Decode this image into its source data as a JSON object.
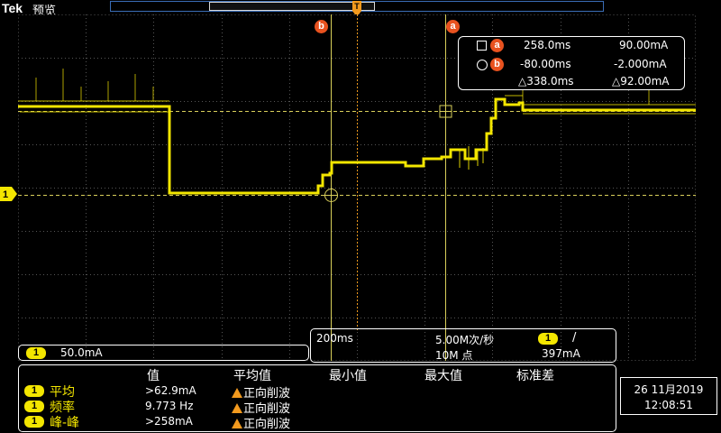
{
  "header": {
    "brand": "Tek",
    "mode": "预览",
    "trigger_position_marker": "T"
  },
  "cursors": {
    "cursor_b_label": "b",
    "cursor_a_label": "a"
  },
  "cursor_readout": {
    "row_a": {
      "label": "a",
      "time": "258.0ms",
      "value": "90.00mA"
    },
    "row_b": {
      "label": "b",
      "time": "-80.00ms",
      "value": "-2.000mA"
    },
    "delta": {
      "time": "△338.0ms",
      "value": "△92.00mA"
    }
  },
  "channel": {
    "label": "1",
    "scale": "50.0mA",
    "color": "#f3e600"
  },
  "timebase": {
    "horizontal_scale": "200ms",
    "sample_rate": "5.00M次/秒",
    "record_length": "10M 点",
    "trigger_channel": "1",
    "trigger_slope": "/",
    "trigger_level": "397mA"
  },
  "measurements": {
    "headers": [
      "值",
      "平均值",
      "最小值",
      "最大值",
      "标准差"
    ],
    "rows": [
      {
        "channel": "1",
        "name": "平均",
        "value": ">62.9mA",
        "status": "正向削波"
      },
      {
        "channel": "1",
        "name": "频率",
        "value": "9.773 Hz",
        "status": "正向削波"
      },
      {
        "channel": "1",
        "name": "峰-峰",
        "value": ">258mA",
        "status": "正向削波"
      }
    ]
  },
  "clock": {
    "date": "26 11月2019",
    "time": "12:08:51"
  },
  "colors": {
    "trace": "#f3e600",
    "cursor_badge": "#e8521f",
    "record_bar": "#3a6db6",
    "warning": "#f39a1e"
  }
}
